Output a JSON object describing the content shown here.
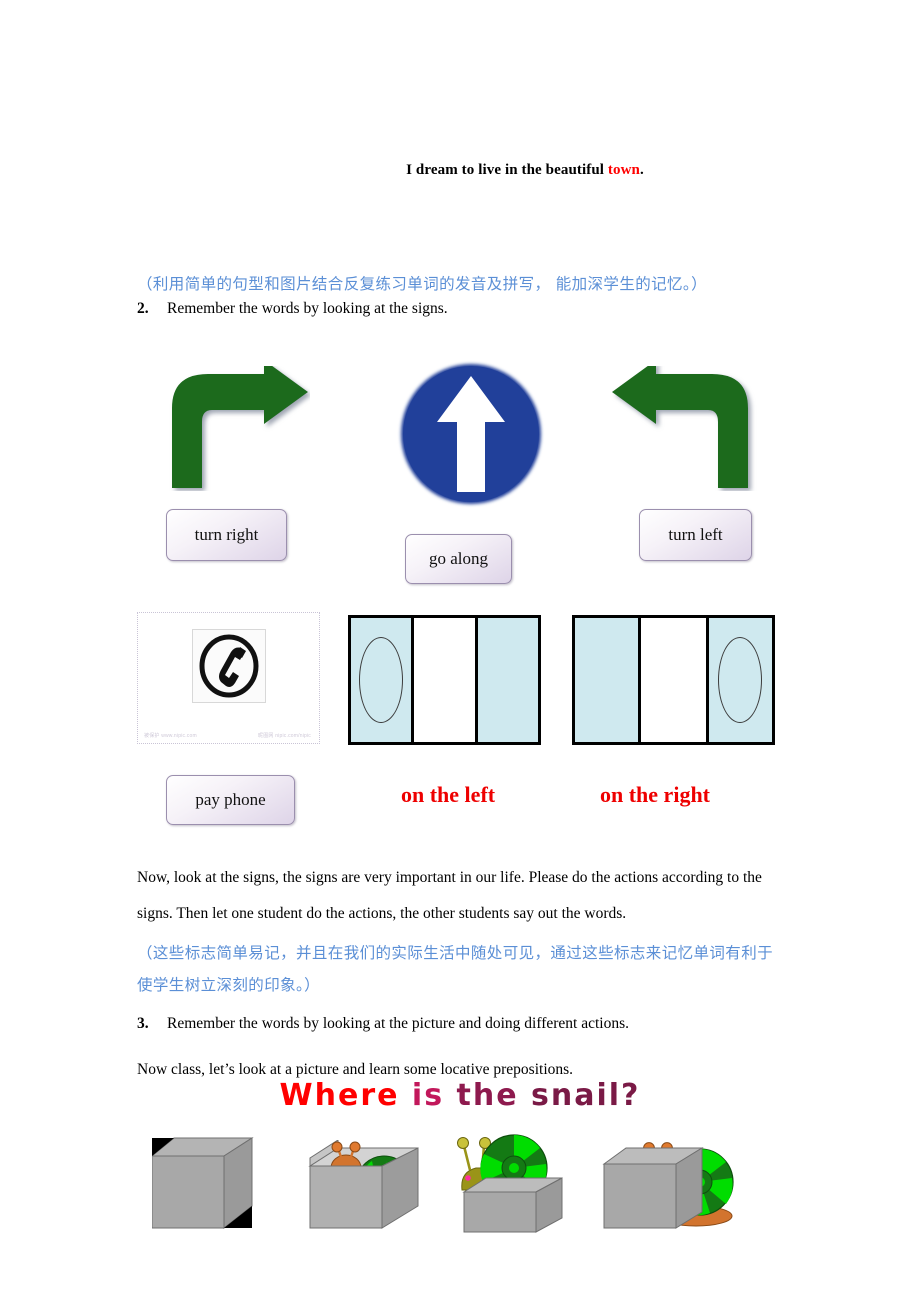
{
  "document": {
    "header_sentence": {
      "prefix": "I dream to live in the beautiful ",
      "highlight": "town",
      "suffix": "."
    },
    "note_1": "（利用简单的句型和图片结合反复练习单词的发音及拼写， 能加深学生的记忆。）",
    "item_2": {
      "number": "2.",
      "text": "Remember the words by looking at the signs."
    },
    "signs_row_1": [
      {
        "id": "turn-right",
        "label": "turn right",
        "icon": "arrow-turn-right-icon"
      },
      {
        "id": "go-along",
        "label": "go along",
        "icon": "blue-circle-up-arrow-icon"
      },
      {
        "id": "turn-left",
        "label": "turn left",
        "icon": "arrow-turn-left-icon"
      }
    ],
    "signs_row_2": [
      {
        "id": "pay-phone",
        "label": "pay phone",
        "icon": "telephone-handset-icon",
        "style": "chip"
      },
      {
        "id": "on-the-left",
        "label": "on the left",
        "icon": "lane-diagram-left-icon",
        "style": "red"
      },
      {
        "id": "on-the-right",
        "label": "on the right",
        "icon": "lane-diagram-right-icon",
        "style": "red"
      }
    ],
    "phone_watermarks": {
      "left": "被保护 www.nipic.com",
      "right": "昵图网  nipic.com/nipic"
    },
    "paragraph_1": "Now, look at the signs, the signs are very important in our life. Please do the actions according to the signs. Then let one student do the actions, the other students say out the words.",
    "note_2": "（这些标志简单易记，并且在我们的实际生活中随处可见，通过这些标志来记忆单词有利于使学生树立深刻的印象。）",
    "item_3": {
      "number": "3.",
      "text": "Remember the words by looking at the picture and doing different actions."
    },
    "paragraph_2": "Now class, let’s look at a picture and learn some locative prepositions.",
    "snail_title": {
      "w1": "Where",
      "w2": "is",
      "w3": "the",
      "w4": "snail?"
    },
    "snail_pictures": [
      {
        "id": "empty-box",
        "icon": "gray-cube-icon"
      },
      {
        "id": "snail-in-box",
        "icon": "snail-in-box-icon"
      },
      {
        "id": "snail-on-box",
        "icon": "snail-on-box-icon"
      },
      {
        "id": "snail-behind-box",
        "icon": "snail-behind-box-icon"
      }
    ],
    "colors": {
      "red": "#ff0000",
      "blue_note": "#5b8fd6",
      "arrow_green": "#1d6b1d",
      "sign_blue": "#21409a",
      "lane_shade": "#cfe9ef",
      "cube_gray": "#a8a8a8",
      "shell_green": "#00cc00"
    }
  }
}
